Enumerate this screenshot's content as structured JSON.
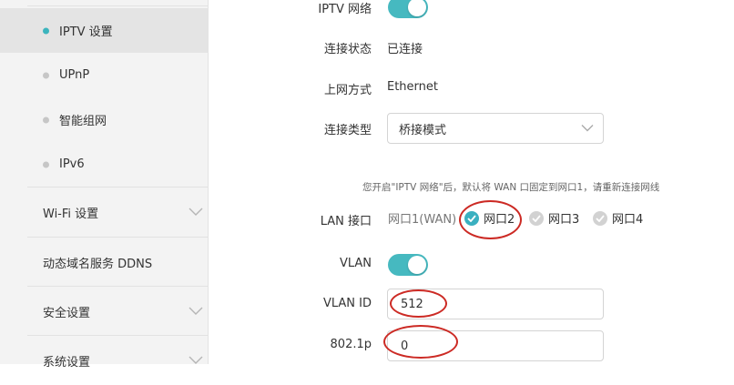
{
  "sidebar": {
    "sub_items": [
      {
        "label": "IPTV 设置",
        "active": true
      },
      {
        "label": "UPnP",
        "active": false
      },
      {
        "label": "智能组网",
        "active": false
      },
      {
        "label": "IPv6",
        "active": false
      }
    ],
    "main_items": [
      {
        "label": "Wi-Fi 设置",
        "has_chevron": true
      },
      {
        "label": "动态域名服务 DDNS",
        "has_chevron": false
      },
      {
        "label": "安全设置",
        "has_chevron": true
      },
      {
        "label": "系统设置",
        "has_chevron": true
      }
    ]
  },
  "form": {
    "iptv_label": "IPTV 网络",
    "iptv_enabled": true,
    "status_label": "连接状态",
    "status_value": "已连接",
    "internet_label": "上网方式",
    "internet_value": "Ethernet",
    "conn_type_label": "连接类型",
    "conn_type_value": "桥接模式",
    "hint": "您开启\"IPTV 网络\"后，默认将 WAN 口固定到网口1，请重新连接网线",
    "lan_label": "LAN 接口",
    "lan_ports": [
      {
        "label": "网口1(WAN)",
        "state": "disabled"
      },
      {
        "label": "网口2",
        "state": "checked"
      },
      {
        "label": "网口3",
        "state": "unchecked"
      },
      {
        "label": "网口4",
        "state": "unchecked"
      }
    ],
    "vlan_label": "VLAN",
    "vlan_enabled": true,
    "vlan_id_label": "VLAN ID",
    "vlan_id_value": "512",
    "priority_label": "802.1p",
    "priority_value": "0"
  },
  "colors": {
    "accent": "#46b9c0",
    "annotation": "#cc2a24"
  }
}
